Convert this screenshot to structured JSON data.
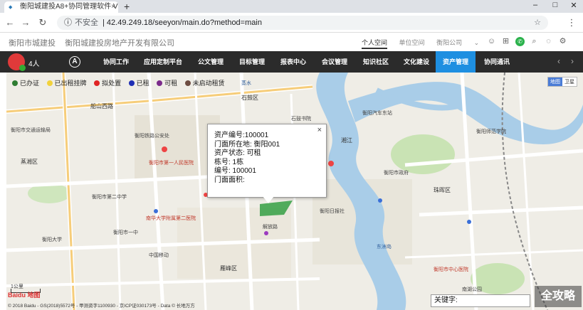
{
  "browser": {
    "tab_title": "衡阳城建投A8+协同管理软件 V",
    "url_secure_label": "不安全",
    "url": "42.49.249.18/seeyon/main.do?method=main"
  },
  "header": {
    "brand_1": "衡阳市城建投",
    "brand_2": "衡阳城建投房地产开发有限公司",
    "links": [
      "个人空间",
      "单位空间",
      "衡阳公司"
    ]
  },
  "navbar": {
    "user_count": "4人",
    "logo": "A",
    "items": [
      "协同工作",
      "应用定制平台",
      "公文管理",
      "目标管理",
      "报表中心",
      "会议管理",
      "知识社区",
      "文化建设",
      "资产管理",
      "协同通讯"
    ],
    "active_index": 8,
    "active_color": "#1e8fe1"
  },
  "legend": [
    {
      "label": "已办证",
      "color": "#2e7d32"
    },
    {
      "label": "已出租挂牌",
      "color": "#f2d23c"
    },
    {
      "label": "拟处置",
      "color": "#e02424"
    },
    {
      "label": "已租",
      "color": "#1f2fb5"
    },
    {
      "label": "可租",
      "color": "#7b2a8b"
    },
    {
      "label": "未启动租赁",
      "color": "#6d4c41"
    }
  ],
  "map_switch": [
    "地图",
    "卫星"
  ],
  "popup": {
    "rows": [
      "资产编号:100001",
      "门面所在地: 衡阳001",
      "资产状态: 可租",
      "栋号: 1栋",
      "编号: 100001",
      "门面面积:"
    ],
    "close": "×"
  },
  "map_labels": [
    "船山西路",
    "衡阳铁路公安处",
    "衡阳市交通运输局",
    "衡阳市第一人民医院",
    "衡阳市第二中学",
    "衡阳大学",
    "南华大学附属第二医院",
    "湘江",
    "衡阳汽车东站",
    "石鼓书院",
    "衡阳市政府",
    "衡阳师范学院",
    "珠晖区",
    "雁峰区",
    "石鼓区",
    "蒸湘区",
    "解放路",
    "衡阳市一中",
    "衡阳日报社",
    "衡阳市中心医院",
    "中国移动",
    "蒸水",
    "东洲岛",
    "南湖公园"
  ],
  "scale_text": "1公里",
  "baidu_logo": "Baidu 地图",
  "copyright": "© 2018 Baidu - GS(2018)5572号 - 甲测资字1100930 - 京ICP证030173号 - Data © 长地万方",
  "keyword_label": "关键字:",
  "watermark": "全攻略"
}
